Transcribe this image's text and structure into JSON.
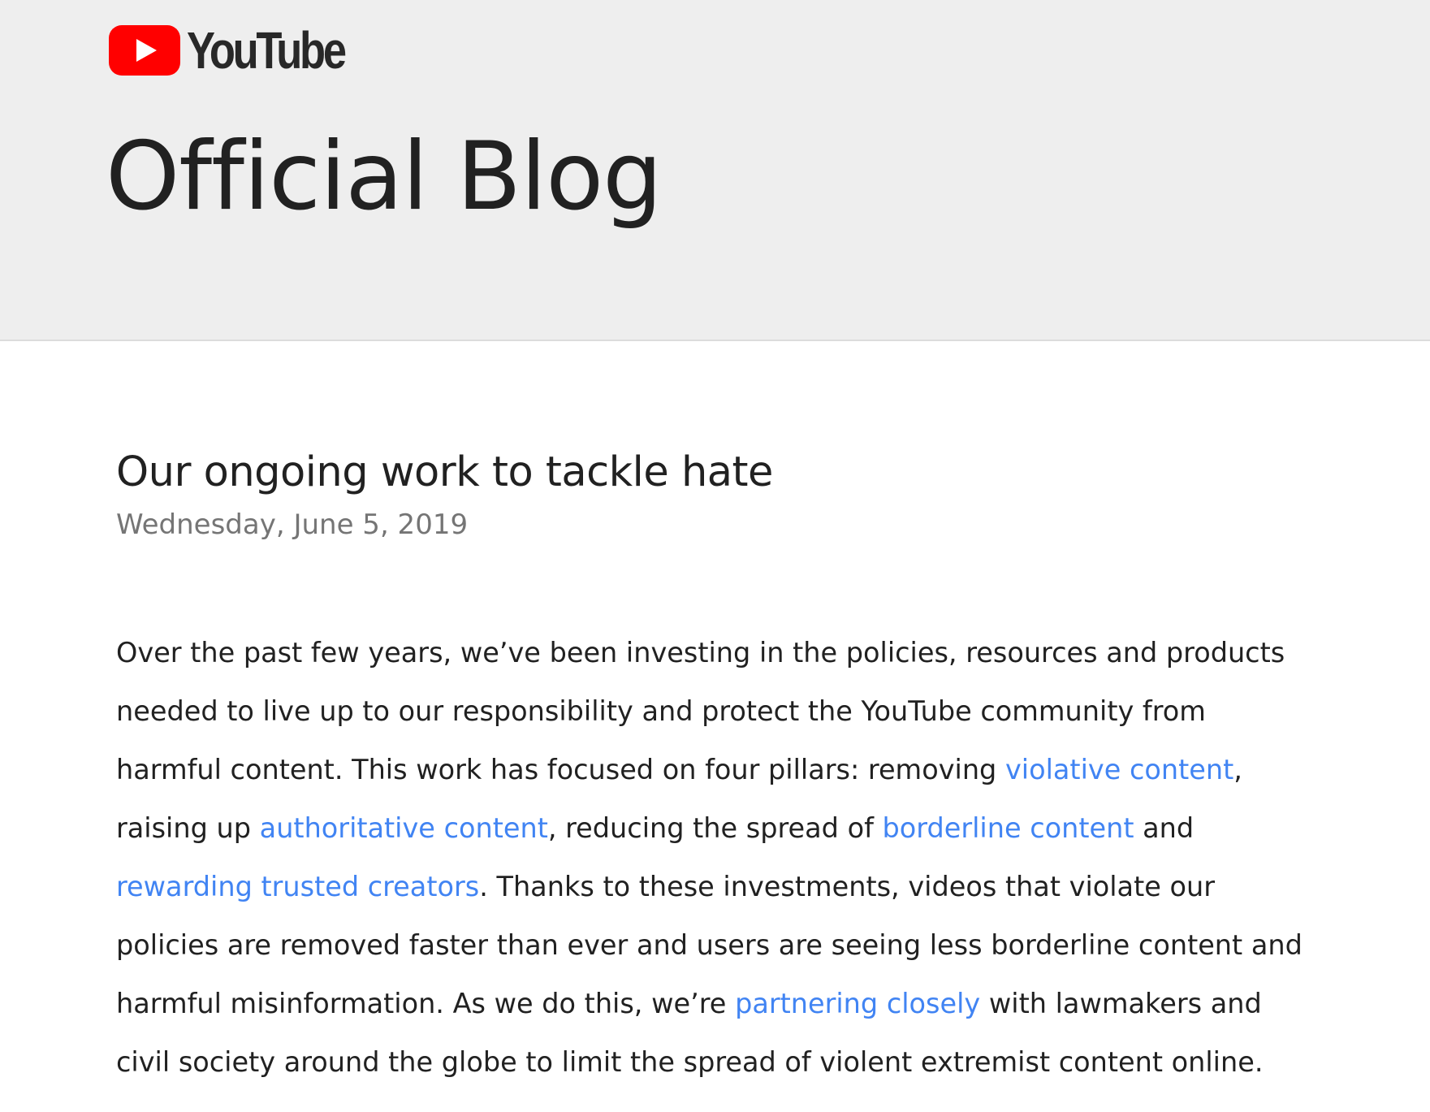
{
  "header": {
    "brand_name": "YouTube",
    "blog_title": "Official Blog",
    "brand_red": "#ff0000",
    "logo_icon": "youtube-play-icon"
  },
  "post": {
    "title": "Our ongoing work to tackle hate",
    "date": "Wednesday, June 5, 2019",
    "body": {
      "t1": "Over the past few years, we’ve been investing in the policies, resources and products needed to live up to our responsibility and protect the YouTube community from harmful content. This work has focused on four pillars: removing ",
      "link1": "violative content",
      "t2": ", raising up ",
      "link2": "authoritative content",
      "t3": ", reducing the spread of ",
      "link3": "borderline content",
      "t4": " and ",
      "link4": "rewarding trusted creators",
      "t5": ". Thanks to these investments, videos that violate our policies are removed faster than ever and users are seeing less borderline content and harmful misinformation. As we do this, we’re ",
      "link5": "partnering closely",
      "t6": " with lawmakers and civil society around the globe to limit the spread of violent extremist content online."
    },
    "link_color": "#4184f3"
  }
}
